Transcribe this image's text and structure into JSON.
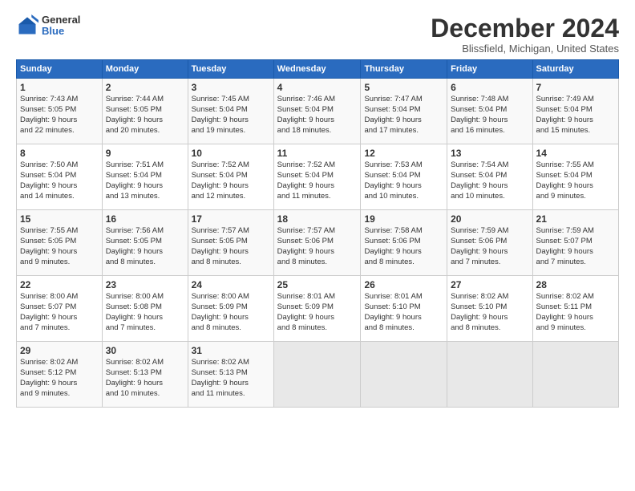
{
  "header": {
    "logo_general": "General",
    "logo_blue": "Blue",
    "title": "December 2024",
    "subtitle": "Blissfield, Michigan, United States"
  },
  "weekdays": [
    "Sunday",
    "Monday",
    "Tuesday",
    "Wednesday",
    "Thursday",
    "Friday",
    "Saturday"
  ],
  "rows": [
    [
      {
        "day": "1",
        "lines": [
          "Sunrise: 7:43 AM",
          "Sunset: 5:05 PM",
          "Daylight: 9 hours",
          "and 22 minutes."
        ]
      },
      {
        "day": "2",
        "lines": [
          "Sunrise: 7:44 AM",
          "Sunset: 5:05 PM",
          "Daylight: 9 hours",
          "and 20 minutes."
        ]
      },
      {
        "day": "3",
        "lines": [
          "Sunrise: 7:45 AM",
          "Sunset: 5:04 PM",
          "Daylight: 9 hours",
          "and 19 minutes."
        ]
      },
      {
        "day": "4",
        "lines": [
          "Sunrise: 7:46 AM",
          "Sunset: 5:04 PM",
          "Daylight: 9 hours",
          "and 18 minutes."
        ]
      },
      {
        "day": "5",
        "lines": [
          "Sunrise: 7:47 AM",
          "Sunset: 5:04 PM",
          "Daylight: 9 hours",
          "and 17 minutes."
        ]
      },
      {
        "day": "6",
        "lines": [
          "Sunrise: 7:48 AM",
          "Sunset: 5:04 PM",
          "Daylight: 9 hours",
          "and 16 minutes."
        ]
      },
      {
        "day": "7",
        "lines": [
          "Sunrise: 7:49 AM",
          "Sunset: 5:04 PM",
          "Daylight: 9 hours",
          "and 15 minutes."
        ]
      }
    ],
    [
      {
        "day": "8",
        "lines": [
          "Sunrise: 7:50 AM",
          "Sunset: 5:04 PM",
          "Daylight: 9 hours",
          "and 14 minutes."
        ]
      },
      {
        "day": "9",
        "lines": [
          "Sunrise: 7:51 AM",
          "Sunset: 5:04 PM",
          "Daylight: 9 hours",
          "and 13 minutes."
        ]
      },
      {
        "day": "10",
        "lines": [
          "Sunrise: 7:52 AM",
          "Sunset: 5:04 PM",
          "Daylight: 9 hours",
          "and 12 minutes."
        ]
      },
      {
        "day": "11",
        "lines": [
          "Sunrise: 7:52 AM",
          "Sunset: 5:04 PM",
          "Daylight: 9 hours",
          "and 11 minutes."
        ]
      },
      {
        "day": "12",
        "lines": [
          "Sunrise: 7:53 AM",
          "Sunset: 5:04 PM",
          "Daylight: 9 hours",
          "and 10 minutes."
        ]
      },
      {
        "day": "13",
        "lines": [
          "Sunrise: 7:54 AM",
          "Sunset: 5:04 PM",
          "Daylight: 9 hours",
          "and 10 minutes."
        ]
      },
      {
        "day": "14",
        "lines": [
          "Sunrise: 7:55 AM",
          "Sunset: 5:04 PM",
          "Daylight: 9 hours",
          "and 9 minutes."
        ]
      }
    ],
    [
      {
        "day": "15",
        "lines": [
          "Sunrise: 7:55 AM",
          "Sunset: 5:05 PM",
          "Daylight: 9 hours",
          "and 9 minutes."
        ]
      },
      {
        "day": "16",
        "lines": [
          "Sunrise: 7:56 AM",
          "Sunset: 5:05 PM",
          "Daylight: 9 hours",
          "and 8 minutes."
        ]
      },
      {
        "day": "17",
        "lines": [
          "Sunrise: 7:57 AM",
          "Sunset: 5:05 PM",
          "Daylight: 9 hours",
          "and 8 minutes."
        ]
      },
      {
        "day": "18",
        "lines": [
          "Sunrise: 7:57 AM",
          "Sunset: 5:06 PM",
          "Daylight: 9 hours",
          "and 8 minutes."
        ]
      },
      {
        "day": "19",
        "lines": [
          "Sunrise: 7:58 AM",
          "Sunset: 5:06 PM",
          "Daylight: 9 hours",
          "and 8 minutes."
        ]
      },
      {
        "day": "20",
        "lines": [
          "Sunrise: 7:59 AM",
          "Sunset: 5:06 PM",
          "Daylight: 9 hours",
          "and 7 minutes."
        ]
      },
      {
        "day": "21",
        "lines": [
          "Sunrise: 7:59 AM",
          "Sunset: 5:07 PM",
          "Daylight: 9 hours",
          "and 7 minutes."
        ]
      }
    ],
    [
      {
        "day": "22",
        "lines": [
          "Sunrise: 8:00 AM",
          "Sunset: 5:07 PM",
          "Daylight: 9 hours",
          "and 7 minutes."
        ]
      },
      {
        "day": "23",
        "lines": [
          "Sunrise: 8:00 AM",
          "Sunset: 5:08 PM",
          "Daylight: 9 hours",
          "and 7 minutes."
        ]
      },
      {
        "day": "24",
        "lines": [
          "Sunrise: 8:00 AM",
          "Sunset: 5:09 PM",
          "Daylight: 9 hours",
          "and 8 minutes."
        ]
      },
      {
        "day": "25",
        "lines": [
          "Sunrise: 8:01 AM",
          "Sunset: 5:09 PM",
          "Daylight: 9 hours",
          "and 8 minutes."
        ]
      },
      {
        "day": "26",
        "lines": [
          "Sunrise: 8:01 AM",
          "Sunset: 5:10 PM",
          "Daylight: 9 hours",
          "and 8 minutes."
        ]
      },
      {
        "day": "27",
        "lines": [
          "Sunrise: 8:02 AM",
          "Sunset: 5:10 PM",
          "Daylight: 9 hours",
          "and 8 minutes."
        ]
      },
      {
        "day": "28",
        "lines": [
          "Sunrise: 8:02 AM",
          "Sunset: 5:11 PM",
          "Daylight: 9 hours",
          "and 9 minutes."
        ]
      }
    ],
    [
      {
        "day": "29",
        "lines": [
          "Sunrise: 8:02 AM",
          "Sunset: 5:12 PM",
          "Daylight: 9 hours",
          "and 9 minutes."
        ]
      },
      {
        "day": "30",
        "lines": [
          "Sunrise: 8:02 AM",
          "Sunset: 5:13 PM",
          "Daylight: 9 hours",
          "and 10 minutes."
        ]
      },
      {
        "day": "31",
        "lines": [
          "Sunrise: 8:02 AM",
          "Sunset: 5:13 PM",
          "Daylight: 9 hours",
          "and 11 minutes."
        ]
      },
      null,
      null,
      null,
      null
    ]
  ]
}
